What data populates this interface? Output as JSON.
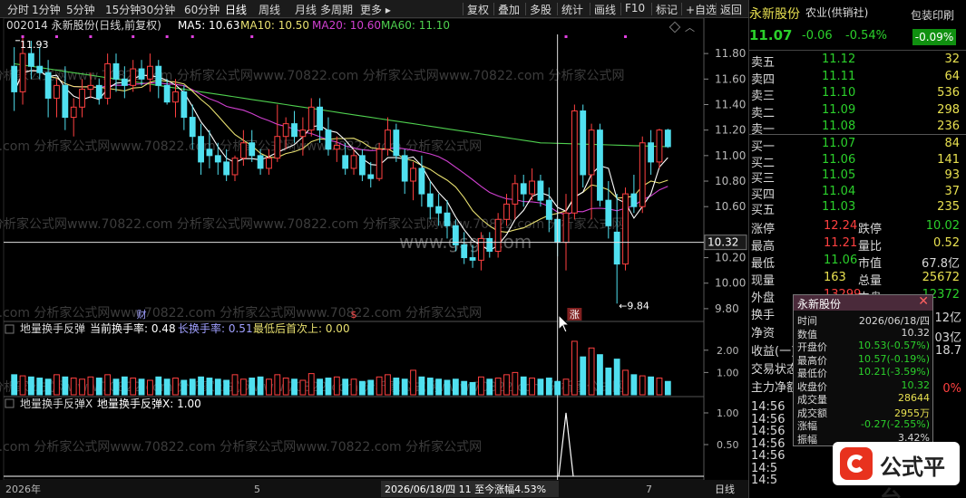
{
  "toolbar": {
    "left": [
      "分时",
      "1分钟",
      "5分钟",
      "15分钟",
      "30分钟",
      "60分钟",
      "日线",
      "周线",
      "月线",
      "多周期",
      "更多 ▸"
    ],
    "right": [
      "复权",
      "叠加",
      "多股",
      "统计",
      "画线",
      "F10",
      "标记",
      "+自选",
      "返回"
    ]
  },
  "header": {
    "code_name": "002014 永新股份(日线,前复权)",
    "ma5": "MA5: 10.63",
    "ma10": "MA10: 10.50",
    "ma20": "MA20: 10.60",
    "ma60": "MA60: 11.10"
  },
  "annotations": {
    "high_label": "11.93",
    "low_label": "←9.84",
    "price_tag": "10.32",
    "event_cai": "财",
    "event_dollar": "$",
    "event_zhang": "涨",
    "watermark": "www.gsgt.com",
    "wm1": "分析家公式网www.70822.com  分析家公式网www.70822.com  分析家公式网www.70822.com  分析家公式网",
    "wm2": "e.com  分析家公式网www.70822.com  分析家公式网www.70822.com  分析家公式网"
  },
  "price_axis": [
    "11.80",
    "11.60",
    "11.40",
    "11.20",
    "11.00",
    "10.80",
    "10.60",
    "10.20",
    "10.00",
    "9.80"
  ],
  "indicator1": {
    "name": "地量换手反弹",
    "current": "当前换手率: 0.48",
    "long": "长换手率: 0.51",
    "last": "最低后首次上: 0.00",
    "axis": [
      "2.00",
      "1.00"
    ]
  },
  "indicator2": {
    "name": "地量换手反弹X",
    "value": "地量换手反弹X: 1.00",
    "axis": [
      "1.00",
      "0.50"
    ]
  },
  "bottom_bar": {
    "year": "2026年",
    "tick5": "5",
    "date_info": "2026/06/18/四 11 至今涨幅4.53%",
    "tick7": "7",
    "period": "日线"
  },
  "quote": {
    "name": "永新股份",
    "industry": "农业(供销社)",
    "tag": "包装印刷",
    "tag_pct": "-0.09%",
    "price": "11.07",
    "change": "-0.06",
    "change_pct": "-0.54%",
    "asks": [
      {
        "label": "卖五",
        "price": "11.12",
        "vol": "32"
      },
      {
        "label": "卖四",
        "price": "11.11",
        "vol": "64"
      },
      {
        "label": "卖三",
        "price": "11.10",
        "vol": "536"
      },
      {
        "label": "卖二",
        "price": "11.09",
        "vol": "298"
      },
      {
        "label": "卖一",
        "price": "11.08",
        "vol": "236"
      }
    ],
    "bids": [
      {
        "label": "买一",
        "price": "11.07",
        "vol": "84"
      },
      {
        "label": "买二",
        "price": "11.06",
        "vol": "141"
      },
      {
        "label": "买三",
        "price": "11.05",
        "vol": "93"
      },
      {
        "label": "买四",
        "price": "11.04",
        "vol": "37"
      },
      {
        "label": "买五",
        "price": "11.03",
        "vol": "235"
      }
    ],
    "stats": [
      {
        "l1": "涨停",
        "v1": "12.24",
        "l2": "跌停",
        "v2": "10.02"
      },
      {
        "l1": "最高",
        "v1": "11.21",
        "l2": "量比",
        "v2": "0.52"
      },
      {
        "l1": "最低",
        "v1": "11.06",
        "l2": "市值",
        "v2": "67.8亿"
      },
      {
        "l1": "现量",
        "v1": "163",
        "l2": "总量",
        "v2": "25672"
      },
      {
        "l1": "外盘",
        "v1": "13299",
        "l2": "内盘",
        "v2": "12372"
      }
    ],
    "misc_labels": [
      "换手",
      "净资",
      "收益(一)",
      "交易状态",
      "主力净额"
    ],
    "misc_right": [
      "12亿",
      "03亿",
      "18.7",
      "0%"
    ],
    "ticks": [
      "14:56",
      "14:56",
      "14:56",
      "14:56",
      "14:56",
      "14:5",
      "14:5"
    ]
  },
  "popup": {
    "title": "永新股份",
    "rows": [
      {
        "k": "时间",
        "v": "2026/06/18/四"
      },
      {
        "k": "数值",
        "v": "10.32"
      },
      {
        "k": "开盘价",
        "v": "10.53(-0.57%)"
      },
      {
        "k": "最高价",
        "v": "10.57(-0.19%)"
      },
      {
        "k": "最低价",
        "v": "10.21(-3.59%)"
      },
      {
        "k": "收盘价",
        "v": "10.32"
      },
      {
        "k": "成交量",
        "v": "28644"
      },
      {
        "k": "成交额",
        "v": "2955万"
      },
      {
        "k": "涨幅",
        "v": "-0.27(-2.55%)"
      },
      {
        "k": "振幅",
        "v": "3.42%"
      }
    ]
  },
  "logo": {
    "text": "公式平台"
  },
  "chart_data": {
    "type": "candlestick",
    "price_range": [
      9.7,
      11.95
    ],
    "candles": [
      [
        11.7,
        11.85,
        11.35,
        11.5
      ],
      [
        11.5,
        11.93,
        11.4,
        11.8
      ],
      [
        11.8,
        11.9,
        11.6,
        11.7
      ],
      [
        11.7,
        11.85,
        11.6,
        11.65
      ],
      [
        11.65,
        11.75,
        11.3,
        11.45
      ],
      [
        11.45,
        11.6,
        11.3,
        11.55
      ],
      [
        11.55,
        11.7,
        11.2,
        11.3
      ],
      [
        11.3,
        11.45,
        11.15,
        11.38
      ],
      [
        11.38,
        11.6,
        11.3,
        11.52
      ],
      [
        11.52,
        11.65,
        11.45,
        11.55
      ],
      [
        11.55,
        11.6,
        11.4,
        11.45
      ],
      [
        11.45,
        11.8,
        11.4,
        11.72
      ],
      [
        11.72,
        11.8,
        11.5,
        11.6
      ],
      [
        11.6,
        11.7,
        11.45,
        11.55
      ],
      [
        11.55,
        11.75,
        11.5,
        11.68
      ],
      [
        11.68,
        11.75,
        11.55,
        11.6
      ],
      [
        11.6,
        11.8,
        11.5,
        11.7
      ],
      [
        11.7,
        11.75,
        11.45,
        11.55
      ],
      [
        11.55,
        11.6,
        11.4,
        11.42
      ],
      [
        11.42,
        11.6,
        11.3,
        11.5
      ],
      [
        11.5,
        11.55,
        11.2,
        11.3
      ],
      [
        11.3,
        11.4,
        11.05,
        11.15
      ],
      [
        11.15,
        11.25,
        10.85,
        10.95
      ],
      [
        11.05,
        11.2,
        10.9,
        11.0
      ],
      [
        11.0,
        11.1,
        10.85,
        10.95
      ],
      [
        10.95,
        11.05,
        10.8,
        10.85
      ],
      [
        10.85,
        11.0,
        10.8,
        10.98
      ],
      [
        10.98,
        11.2,
        10.92,
        11.1
      ],
      [
        11.1,
        11.2,
        10.95,
        11.0
      ],
      [
        11.0,
        11.05,
        10.85,
        10.9
      ],
      [
        10.9,
        11.05,
        10.85,
        10.98
      ],
      [
        10.98,
        11.4,
        10.95,
        11.15
      ],
      [
        11.15,
        11.3,
        11.05,
        11.25
      ],
      [
        11.25,
        11.35,
        11.1,
        11.15
      ],
      [
        11.15,
        11.3,
        11.0,
        11.2
      ],
      [
        11.2,
        11.45,
        11.15,
        11.38
      ],
      [
        11.38,
        11.45,
        11.1,
        11.2
      ],
      [
        11.2,
        11.3,
        11.0,
        11.05
      ],
      [
        11.05,
        11.15,
        10.95,
        11.08
      ],
      [
        11.0,
        11.1,
        10.85,
        10.9
      ],
      [
        10.9,
        11.05,
        10.85,
        11.0
      ],
      [
        11.0,
        11.05,
        10.8,
        10.85
      ],
      [
        10.85,
        10.95,
        10.75,
        10.82
      ],
      [
        10.82,
        11.1,
        10.8,
        11.05
      ],
      [
        11.05,
        11.3,
        11.0,
        11.2
      ],
      [
        11.2,
        11.25,
        10.95,
        11.0
      ],
      [
        11.0,
        11.05,
        10.7,
        10.8
      ],
      [
        10.8,
        10.95,
        10.65,
        10.9
      ],
      [
        10.9,
        11.0,
        10.6,
        10.7
      ],
      [
        10.7,
        10.8,
        10.5,
        10.6
      ],
      [
        10.6,
        10.7,
        10.45,
        10.55
      ],
      [
        10.55,
        10.65,
        10.35,
        10.45
      ],
      [
        10.45,
        10.5,
        10.25,
        10.3
      ],
      [
        10.3,
        10.4,
        10.15,
        10.2
      ],
      [
        10.2,
        10.3,
        10.12,
        10.18
      ],
      [
        10.18,
        10.4,
        10.1,
        10.35
      ],
      [
        10.35,
        10.4,
        10.2,
        10.25
      ],
      [
        10.25,
        10.55,
        10.2,
        10.5
      ],
      [
        10.5,
        10.7,
        10.45,
        10.62
      ],
      [
        10.62,
        10.85,
        10.5,
        10.78
      ],
      [
        10.78,
        10.85,
        10.6,
        10.7
      ],
      [
        10.7,
        10.9,
        10.65,
        10.8
      ],
      [
        10.8,
        10.85,
        10.6,
        10.65
      ],
      [
        10.65,
        10.75,
        10.4,
        10.5
      ],
      [
        10.5,
        10.57,
        10.21,
        10.32
      ],
      [
        10.32,
        10.7,
        10.1,
        10.55
      ],
      [
        10.55,
        11.4,
        10.5,
        11.35
      ],
      [
        11.35,
        11.4,
        10.75,
        10.85
      ],
      [
        10.85,
        11.25,
        10.5,
        11.2
      ],
      [
        11.2,
        11.25,
        10.6,
        10.65
      ],
      [
        10.65,
        10.8,
        10.35,
        10.45
      ],
      [
        10.4,
        10.7,
        9.84,
        10.15
      ],
      [
        10.15,
        10.75,
        10.1,
        10.7
      ],
      [
        10.7,
        10.85,
        10.55,
        10.6
      ],
      [
        10.6,
        11.15,
        10.55,
        11.1
      ],
      [
        11.1,
        11.2,
        10.85,
        10.95
      ],
      [
        10.95,
        11.21,
        10.9,
        11.2
      ],
      [
        11.2,
        11.21,
        11.06,
        11.07
      ]
    ],
    "turnover": [
      0.9,
      0.85,
      0.8,
      0.75,
      0.7,
      0.9,
      0.8,
      0.75,
      0.7,
      0.8,
      0.75,
      0.9,
      0.7,
      0.8,
      0.75,
      0.7,
      0.65,
      0.8,
      0.7,
      0.75,
      0.65,
      0.7,
      0.8,
      0.75,
      0.7,
      0.65,
      0.9,
      0.7,
      0.75,
      0.8,
      0.7,
      0.9,
      0.75,
      0.7,
      0.65,
      0.95,
      0.7,
      0.75,
      0.8,
      0.7,
      0.7,
      0.6,
      0.65,
      0.8,
      0.9,
      0.75,
      0.7,
      1.1,
      0.8,
      0.75,
      0.7,
      0.65,
      0.7,
      0.6,
      0.55,
      0.8,
      0.7,
      0.75,
      0.9,
      1.0,
      0.8,
      0.75,
      0.7,
      0.75,
      0.6,
      0.7,
      2.4,
      1.7,
      2.1,
      1.8,
      1.2,
      1.6,
      1.1,
      0.9,
      0.85,
      0.8,
      0.75,
      0.6
    ],
    "x_signal": {
      "index": 65,
      "value": 1.0
    }
  }
}
